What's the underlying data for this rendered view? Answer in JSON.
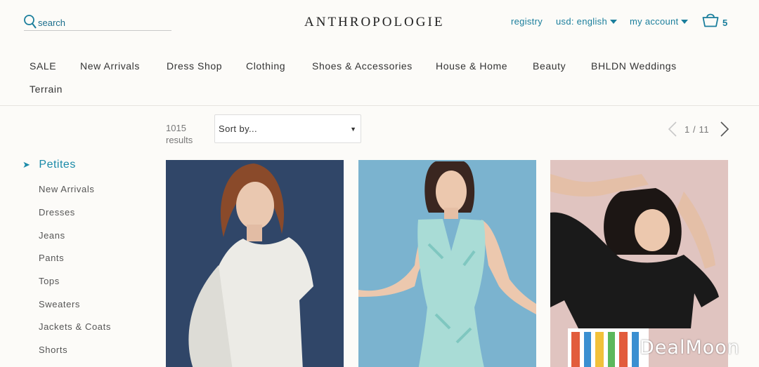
{
  "header": {
    "search_placeholder": "search",
    "logo": "ANTHROPOLOGIE",
    "registry": "registry",
    "currency": "usd: english",
    "account": "my account",
    "cart_count": "5"
  },
  "nav": {
    "items": [
      "SALE",
      "New Arrivals",
      "Dress Shop",
      "Clothing",
      "Shoes & Accessories",
      "House & Home",
      "Beauty",
      "BHLDN Weddings",
      "Terrain"
    ]
  },
  "sidebar": {
    "active": "Petites",
    "items": [
      "New Arrivals",
      "Dresses",
      "Jeans",
      "Pants",
      "Tops",
      "Sweaters",
      "Jackets & Coats",
      "Shorts"
    ]
  },
  "toolbar": {
    "results_count": "1015",
    "results_label": "results",
    "sort_label": "Sort by...",
    "page": "1 / 11"
  },
  "products": [
    {
      "icon": "product-image",
      "background": "#2c4061"
    },
    {
      "icon": "product-image",
      "background": "#7bb3cf"
    },
    {
      "icon": "product-image",
      "background": "#e0c4c0"
    }
  ],
  "watermark": "DealMoon",
  "colors": {
    "accent": "#1a7e9c",
    "background": "#fcfbf8"
  }
}
